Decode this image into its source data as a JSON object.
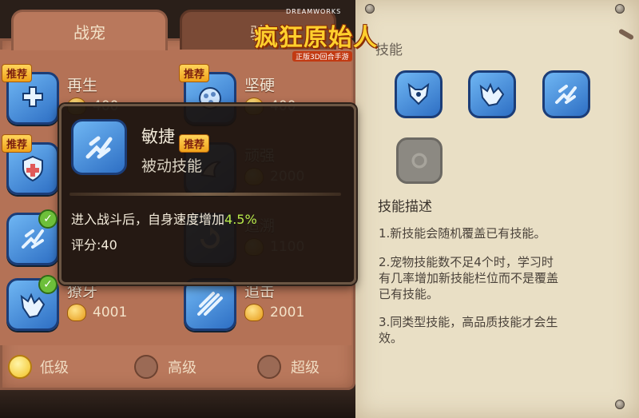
{
  "logo": {
    "brand": "DREAMWORKS",
    "title": "疯狂原始人",
    "subtitle": "正版3D回合手游"
  },
  "tabs": [
    {
      "label": "战宠",
      "active": true
    },
    {
      "label": "骑",
      "active": false
    }
  ],
  "recommend_label": "推荐",
  "skills": [
    {
      "name": "再生",
      "cost": "400",
      "recommended": true,
      "learned": false,
      "icon": "heal-cross-icon"
    },
    {
      "name": "坚硬",
      "cost": "400",
      "recommended": true,
      "learned": false,
      "icon": "armor-skin-icon"
    },
    {
      "name": "",
      "cost": "",
      "recommended": true,
      "learned": false,
      "icon": "shield-cross-icon"
    },
    {
      "name": "顽强",
      "cost": "2000",
      "recommended": true,
      "learned": false,
      "icon": "tenacity-icon"
    },
    {
      "name": "",
      "cost": "",
      "recommended": false,
      "learned": true,
      "icon": "agility-icon"
    },
    {
      "name": "追溯",
      "cost": "1100",
      "recommended": false,
      "learned": false,
      "icon": "trace-icon"
    },
    {
      "name": "獠牙",
      "cost": "4001",
      "recommended": false,
      "learned": true,
      "icon": "fang-icon"
    },
    {
      "name": "追击",
      "cost": "2001",
      "recommended": false,
      "learned": false,
      "icon": "pursuit-icon"
    }
  ],
  "filters": [
    {
      "label": "低级",
      "selected": true
    },
    {
      "label": "高级",
      "selected": false
    },
    {
      "label": "超级",
      "selected": false
    }
  ],
  "tooltip": {
    "name": "敏捷",
    "type": "被动技能",
    "effect_prefix": "进入战斗后，自身速度增加",
    "effect_value": "4.5%",
    "score": "评分:40"
  },
  "right_panel": {
    "title": "技能",
    "owned_icons": [
      "wolf-head-icon",
      "fang-icon",
      "agility-icon"
    ],
    "empty_slot_icon": "empty-slot-icon",
    "desc_title": "技能描述",
    "desc_1": "1.新技能会随机覆盖已有技能。",
    "desc_2_line1": "2.宠物技能数不足4个时，学习时",
    "desc_2_line2": "有几率增加新技能栏位而不是覆盖",
    "desc_2_line3": "已有技能。",
    "desc_3_line1": "3.同类型技能，高品质技能才会生",
    "desc_3_line2": "效。"
  },
  "colors": {
    "wood": "#b9785c",
    "parchment": "#e9dfc5",
    "skill_blue": "#2e6fc4",
    "highlight_green": "#b6e94a",
    "gold": "#f2c021"
  }
}
